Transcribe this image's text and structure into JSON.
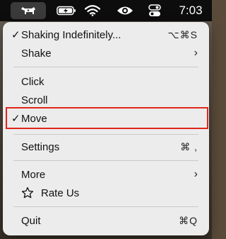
{
  "menubar": {
    "app_icon": "cow-icon",
    "battery_icon": "battery-charging-icon",
    "wifi_icon": "wifi-icon",
    "eye_icon": "eye-icon",
    "control_center_icon": "toggle-icon",
    "clock": "7:03"
  },
  "menu": {
    "shaking": {
      "label": "Shaking Indefinitely...",
      "shortcut": "⌥⌘S",
      "checked": true
    },
    "shake": {
      "label": "Shake",
      "submenu": "›"
    },
    "click": {
      "label": "Click"
    },
    "scroll": {
      "label": "Scroll"
    },
    "move": {
      "label": "Move",
      "checked": true
    },
    "settings": {
      "label": "Settings",
      "shortcut": "⌘ ,"
    },
    "more": {
      "label": "More",
      "submenu": "›"
    },
    "rate": {
      "label": "Rate Us",
      "icon": "star-outline-icon"
    },
    "quit": {
      "label": "Quit",
      "shortcut": "⌘Q"
    }
  },
  "colors": {
    "highlight_border": "#e0261b",
    "menu_bg": "#ececec",
    "menubar_bg": "#0d0d0d"
  }
}
